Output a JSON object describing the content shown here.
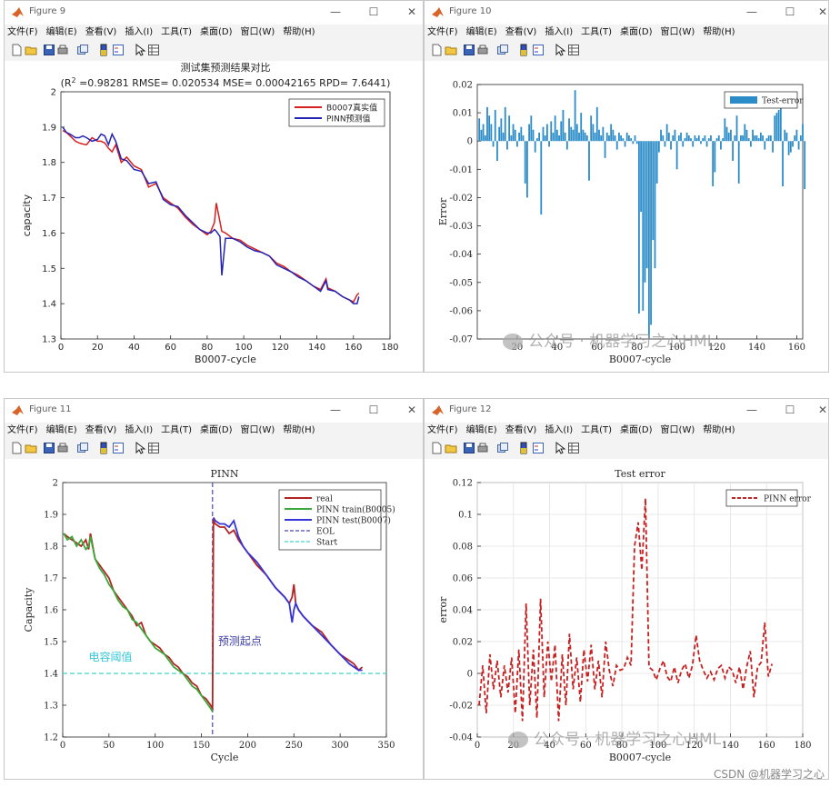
{
  "menu": [
    "文件(F)",
    "编辑(E)",
    "查看(V)",
    "插入(I)",
    "工具(T)",
    "桌面(D)",
    "窗口(W)",
    "帮助(H)"
  ],
  "toolbar_icons": [
    "new-file-icon",
    "open-folder-icon",
    "save-icon",
    "print-icon",
    "copy-figure-icon",
    "colorbar-icon",
    "legend-icon",
    "pointer-icon",
    "property-inspector-icon"
  ],
  "windows": {
    "fig9": {
      "title": "Figure 9"
    },
    "fig10": {
      "title": "Figure 10"
    },
    "fig11": {
      "title": "Figure 11"
    },
    "fig12": {
      "title": "Figure 12"
    }
  },
  "watermark": {
    "text": "公众号 · 机器学习之心HML"
  },
  "credit": "CSDN @机器学习之心",
  "chart_data": [
    {
      "id": "fig9",
      "type": "line",
      "title": "测试集预测结果对比",
      "subtitle": "(R",
      "subtitle_sup": "2",
      "subtitle_rest": " =0.98281 RMSE= 0.020534 MSE= 0.00042165 RPD= 7.6441)",
      "xlabel": "B0007-cycle",
      "ylabel": "capacity",
      "xlim": [
        0,
        180
      ],
      "ylim": [
        1.3,
        2.0
      ],
      "xticks": [
        0,
        20,
        40,
        60,
        80,
        100,
        120,
        140,
        160,
        180
      ],
      "yticks": [
        1.3,
        1.4,
        1.5,
        1.6,
        1.7,
        1.8,
        1.9,
        2
      ],
      "legend_position": "top-right",
      "series": [
        {
          "name": "B0007真实值",
          "color": "#d62020",
          "x": [
            1,
            3,
            5,
            8,
            10,
            12,
            14,
            17,
            20,
            22,
            24,
            26,
            28,
            30,
            33,
            36,
            40,
            44,
            48,
            52,
            56,
            60,
            64,
            68,
            72,
            76,
            80,
            82,
            84,
            85,
            88,
            90,
            94,
            98,
            102,
            106,
            110,
            114,
            118,
            122,
            126,
            130,
            134,
            138,
            142,
            145,
            146,
            150,
            154,
            158,
            160,
            162,
            163
          ],
          "y": [
            1.89,
            1.885,
            1.875,
            1.86,
            1.855,
            1.852,
            1.85,
            1.87,
            1.86,
            1.86,
            1.855,
            1.84,
            1.83,
            1.85,
            1.8,
            1.815,
            1.79,
            1.78,
            1.73,
            1.74,
            1.7,
            1.685,
            1.67,
            1.645,
            1.625,
            1.61,
            1.595,
            1.605,
            1.63,
            1.685,
            1.605,
            1.6,
            1.585,
            1.58,
            1.565,
            1.555,
            1.545,
            1.535,
            1.515,
            1.505,
            1.49,
            1.48,
            1.465,
            1.45,
            1.44,
            1.47,
            1.445,
            1.435,
            1.42,
            1.41,
            1.405,
            1.425,
            1.43
          ]
        },
        {
          "name": "PINN预测值",
          "color": "#2424b4",
          "x": [
            1,
            3,
            5,
            8,
            10,
            12,
            14,
            17,
            20,
            22,
            24,
            26,
            28,
            30,
            33,
            36,
            40,
            44,
            48,
            52,
            56,
            60,
            64,
            68,
            72,
            76,
            80,
            82,
            84,
            85,
            87,
            88,
            90,
            94,
            98,
            102,
            106,
            110,
            114,
            118,
            122,
            126,
            130,
            134,
            138,
            142,
            145,
            146,
            150,
            154,
            158,
            160,
            162,
            163
          ],
          "y": [
            1.9,
            1.885,
            1.88,
            1.87,
            1.87,
            1.875,
            1.87,
            1.86,
            1.865,
            1.88,
            1.875,
            1.85,
            1.88,
            1.86,
            1.81,
            1.805,
            1.78,
            1.775,
            1.74,
            1.745,
            1.695,
            1.68,
            1.675,
            1.65,
            1.63,
            1.61,
            1.6,
            1.6,
            1.61,
            1.605,
            1.59,
            1.48,
            1.585,
            1.585,
            1.575,
            1.56,
            1.55,
            1.545,
            1.535,
            1.51,
            1.5,
            1.49,
            1.475,
            1.465,
            1.45,
            1.435,
            1.465,
            1.44,
            1.435,
            1.42,
            1.41,
            1.4,
            1.4,
            1.42
          ]
        }
      ]
    },
    {
      "id": "fig10",
      "type": "bar",
      "title": "",
      "xlabel": "B0007-cycle",
      "ylabel": "Error",
      "xlim": [
        0,
        163
      ],
      "ylim": [
        -0.07,
        0.02
      ],
      "xticks": [
        20,
        40,
        60,
        80,
        100,
        120,
        140,
        160
      ],
      "yticks": [
        0.02,
        0.01,
        0,
        -0.01,
        -0.02,
        -0.03,
        -0.04,
        -0.05,
        -0.06,
        -0.07
      ],
      "legend_position": "top-right",
      "series": [
        {
          "name": "Test-error",
          "color": "#2c8cc8",
          "values": [
            0.008,
            0.004,
            0.006,
            0.002,
            0.012,
            0.009,
            0.006,
            -0.002,
            0.011,
            -0.007,
            0.005,
            0.008,
            0.003,
            0.012,
            -0.003,
            0.009,
            0.002,
            0.006,
            0.004,
            -0.002,
            0.003,
            0.005,
            0.002,
            -0.015,
            -0.02,
            0.006,
            0.009,
            0.004,
            -0.004,
            0.001,
            0.003,
            -0.026,
            0.005,
            0.002,
            0.006,
            -0.002,
            0.007,
            0.003,
            0.009,
            0.004,
            0.002,
            0.007,
            0.011,
            0.003,
            -0.003,
            0.008,
            0.005,
            0.004,
            0.018,
            0.006,
            0.003,
            0.01,
            0.004,
            0.003,
            0.002,
            -0.014,
            0.009,
            0.006,
            0.003,
            0.012,
            0.004,
            0.002,
            0.005,
            -0.006,
            0.003,
            0.002,
            0.006,
            0.004,
            0.002,
            -0.003,
            0.003,
            0.002,
            0.001,
            -0.002,
            0.003,
            0.002,
            0.001,
            -0.001,
            0.002,
            -0.001,
            -0.061,
            -0.025,
            -0.06,
            -0.05,
            -0.045,
            -0.07,
            -0.065,
            -0.035,
            -0.045,
            -0.015,
            -0.004,
            0.004,
            0.002,
            -0.002,
            0.006,
            0.003,
            -0.003,
            0.002,
            0.004,
            -0.01,
            0.002,
            0.003,
            -0.002,
            0.001,
            0.003,
            0.002,
            0.001,
            -0.002,
            0.002,
            0.001,
            0.002,
            -0.001,
            0.001,
            0.002,
            -0.002,
            0.001,
            0.002,
            -0.016,
            -0.011,
            0.001,
            0.002,
            -0.003,
            0.001,
            0.008,
            0.005,
            0.003,
            0.004,
            -0.007,
            0.002,
            0.009,
            -0.015,
            0.002,
            0.002,
            0.006,
            0.004,
            0.001,
            -0.002,
            0.004,
            0.002,
            0.002,
            0.001,
            0.003,
            0.002,
            -0.003,
            0.001,
            0.002,
            0.002,
            -0.004,
            0.009,
            0.01,
            0.011,
            0.012,
            -0.016,
            0.004,
            0.003,
            -0.005,
            -0.004,
            -0.002,
            0.002,
            0.004,
            -0.003,
            0.002,
            0.006,
            -0.017
          ]
        }
      ]
    },
    {
      "id": "fig11",
      "type": "line",
      "title": "PINN",
      "xlabel": "Cycle",
      "ylabel": "Capacity",
      "xlim": [
        0,
        350
      ],
      "ylim": [
        1.2,
        2.0
      ],
      "xticks": [
        0,
        50,
        100,
        150,
        200,
        250,
        300,
        350
      ],
      "yticks": [
        1.2,
        1.3,
        1.4,
        1.5,
        1.6,
        1.7,
        1.8,
        1.9,
        2
      ],
      "legend_position": "top-right",
      "annotations": [
        {
          "text": "电容阈值",
          "x": 28,
          "y": 1.44,
          "color": "#35c8d8"
        },
        {
          "text": "预测起点",
          "x": 168,
          "y": 1.49,
          "color": "#4040a8"
        }
      ],
      "eol_x": 162,
      "start_y": 1.4,
      "series": [
        {
          "name": "real",
          "color": "#b22424",
          "style": "solid",
          "x": [
            1,
            5,
            10,
            15,
            20,
            25,
            28,
            30,
            35,
            40,
            45,
            50,
            55,
            60,
            65,
            70,
            75,
            80,
            85,
            90,
            95,
            100,
            105,
            110,
            115,
            120,
            125,
            130,
            135,
            140,
            145,
            150,
            155,
            160,
            162,
            163,
            165,
            170,
            175,
            180,
            185,
            190,
            195,
            200,
            210,
            220,
            230,
            240,
            245,
            248,
            250,
            252,
            255,
            260,
            270,
            280,
            290,
            300,
            310,
            315,
            320,
            324
          ],
          "y": [
            1.84,
            1.83,
            1.82,
            1.81,
            1.8,
            1.82,
            1.79,
            1.84,
            1.76,
            1.74,
            1.72,
            1.7,
            1.66,
            1.64,
            1.62,
            1.6,
            1.58,
            1.55,
            1.56,
            1.52,
            1.5,
            1.49,
            1.48,
            1.46,
            1.45,
            1.43,
            1.42,
            1.4,
            1.39,
            1.37,
            1.36,
            1.33,
            1.32,
            1.3,
            1.29,
            1.88,
            1.87,
            1.86,
            1.86,
            1.84,
            1.85,
            1.82,
            1.8,
            1.78,
            1.74,
            1.71,
            1.67,
            1.64,
            1.62,
            1.64,
            1.68,
            1.62,
            1.6,
            1.58,
            1.55,
            1.53,
            1.49,
            1.46,
            1.44,
            1.43,
            1.41,
            1.42
          ]
        },
        {
          "name": "PINN train(B0005)",
          "color": "#3aa83a",
          "style": "solid",
          "x": [
            1,
            5,
            10,
            15,
            20,
            25,
            28,
            30,
            35,
            40,
            45,
            50,
            55,
            60,
            65,
            70,
            75,
            80,
            85,
            90,
            95,
            100,
            105,
            110,
            115,
            120,
            125,
            130,
            135,
            140,
            145,
            150,
            155,
            160,
            162
          ],
          "y": [
            1.84,
            1.82,
            1.83,
            1.8,
            1.82,
            1.79,
            1.8,
            1.83,
            1.76,
            1.73,
            1.71,
            1.68,
            1.66,
            1.63,
            1.61,
            1.6,
            1.57,
            1.56,
            1.54,
            1.52,
            1.5,
            1.48,
            1.47,
            1.46,
            1.44,
            1.42,
            1.41,
            1.4,
            1.38,
            1.36,
            1.35,
            1.33,
            1.31,
            1.29,
            1.28
          ]
        },
        {
          "name": "PINN test(B0007)",
          "color": "#3434d8",
          "style": "solid",
          "x": [
            163,
            165,
            170,
            175,
            180,
            185,
            190,
            195,
            200,
            210,
            220,
            230,
            240,
            245,
            248,
            250,
            252,
            255,
            260,
            270,
            280,
            290,
            300,
            310,
            315,
            320,
            324
          ],
          "y": [
            1.89,
            1.88,
            1.87,
            1.87,
            1.86,
            1.88,
            1.83,
            1.8,
            1.78,
            1.75,
            1.71,
            1.67,
            1.64,
            1.62,
            1.56,
            1.6,
            1.62,
            1.6,
            1.58,
            1.55,
            1.52,
            1.49,
            1.46,
            1.43,
            1.42,
            1.41,
            1.41
          ]
        },
        {
          "name": "EOL",
          "color": "#4848c0",
          "style": "dashed"
        },
        {
          "name": "Start",
          "color": "#40d8d0",
          "style": "dashed"
        }
      ]
    },
    {
      "id": "fig12",
      "type": "line",
      "title": "Test error",
      "xlabel": "B0007-cycle",
      "ylabel": "error",
      "xlim": [
        0,
        180
      ],
      "ylim": [
        -0.04,
        0.12
      ],
      "xticks": [
        0,
        20,
        40,
        60,
        80,
        100,
        120,
        140,
        160,
        180
      ],
      "yticks": [
        -0.04,
        -0.02,
        0,
        0.02,
        0.04,
        0.06,
        0.08,
        0.1,
        0.12
      ],
      "legend_position": "top-right",
      "series": [
        {
          "name": "PINN error",
          "color": "#c82020",
          "style": "dashed",
          "x": [
            1,
            3,
            5,
            7,
            9,
            11,
            13,
            15,
            17,
            19,
            21,
            23,
            25,
            27,
            29,
            31,
            33,
            35,
            37,
            39,
            41,
            43,
            45,
            47,
            49,
            51,
            53,
            55,
            57,
            59,
            61,
            63,
            65,
            67,
            69,
            71,
            73,
            75,
            77,
            79,
            81,
            83,
            85,
            87,
            89,
            91,
            93,
            95,
            97,
            99,
            101,
            103,
            105,
            107,
            109,
            111,
            113,
            115,
            117,
            119,
            121,
            123,
            125,
            127,
            129,
            131,
            133,
            135,
            137,
            139,
            141,
            143,
            145,
            147,
            149,
            151,
            153,
            155,
            157,
            159,
            161,
            163
          ],
          "y": [
            -0.02,
            0.005,
            -0.025,
            0.012,
            -0.01,
            0.008,
            -0.015,
            0.005,
            -0.012,
            0.01,
            -0.025,
            0.015,
            -0.03,
            0.044,
            -0.02,
            0.015,
            -0.028,
            0.047,
            -0.015,
            0.02,
            -0.005,
            0.018,
            -0.03,
            0.012,
            -0.02,
            0.025,
            -0.01,
            0.01,
            -0.018,
            0.015,
            -0.005,
            0.018,
            -0.01,
            0.008,
            -0.015,
            0.02,
            0.002,
            -0.008,
            0.005,
            0.002,
            0.003,
            0.01,
            0.005,
            0.08,
            0.095,
            0.065,
            0.11,
            0.004,
            0.002,
            -0.004,
            0.003,
            0.008,
            -0.002,
            -0.005,
            0.004,
            -0.006,
            0.002,
            0.006,
            -0.003,
            0.005,
            0.024,
            0.008,
            0.002,
            -0.003,
            0.001,
            -0.004,
            0.003,
            0.005,
            -0.003,
            0.004,
            0.002,
            -0.006,
            0.004,
            -0.01,
            0.004,
            0.014,
            -0.015,
            0.004,
            0.007,
            0.032,
            -0.002,
            0.006
          ]
        }
      ]
    }
  ]
}
